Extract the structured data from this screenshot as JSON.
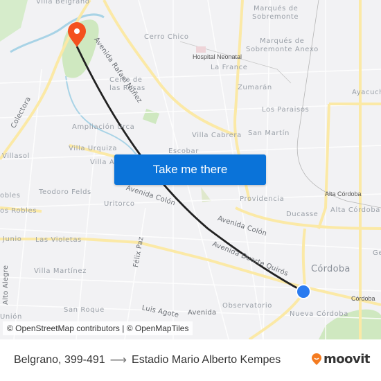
{
  "map": {
    "labels": {
      "villa_belgrano": "Villa Belgrano",
      "cerro_chico": "Cerro Chico",
      "cerro_rosas_1": "Cerro de",
      "cerro_rosas_2": "las Rosas",
      "av_rafael_nunez": "Avenida Rafael Núñez",
      "marques_1": "Marqués de",
      "marques_2": "Sobremonte",
      "marques_anexo_1": "Marqués de",
      "marques_anexo_2": "Sobremonte Anexo",
      "hospital": "Hospital Neonatal",
      "la_france": "La France",
      "zumaran": "Zumarán",
      "ayacucho": "Ayacucho",
      "colectora": "Colectora",
      "los_paraisos": "Los Paraisos",
      "ampliacion_urca": "Ampliación Urca",
      "villa_cabrera": "Villa Cabrera",
      "san_martin": "San Martín",
      "villasol": "Villasol",
      "villa_urquiza": "Villa Urquiza",
      "escobar": "Escobar",
      "villa_a": "Villa A",
      "teodoro_felds": "Teodoro Felds",
      "obles": "obles",
      "los_robles": "os Robles",
      "uritorco": "Uritorco",
      "av_colon_1": "Avenida Colón",
      "av_colon_2": "Avenida Colón",
      "alta_cordoba_poi": "Alta Córdoba",
      "alta_cordoba": "Alta Córdoba",
      "providencia": "Providencia",
      "ducasse": "Ducasse",
      "junio": "Junio",
      "las_violetas": "Las Violetas",
      "felix_paz": "Félix Paz",
      "av_duarte_quiros": "Avenida Duarte Quirós",
      "cordoba_city": "Córdoba",
      "villa_martinez": "Villa Martínez",
      "alto_alegre": "Alto Alegre",
      "ge": "Ge",
      "cordoba_poi": "Córdoba",
      "san_roque": "San Roque",
      "luis_agote": "Luis Agote",
      "avenida": "Avenida",
      "observatorio": "Observatorio",
      "union": "Unión",
      "nueva_cordoba": "Nueva Córdoba"
    },
    "cta_label": "Take me there",
    "attribution": "© OpenStreetMap contributors | © OpenMapTiles",
    "colors": {
      "destination_pin": "#f4511e",
      "origin_dot": "#2a7bf0",
      "route_line": "#222222",
      "cta_bg": "#0a73d9",
      "major_road": "#fbe9a6",
      "park": "#cfe8c0",
      "water": "#a8d3e6"
    }
  },
  "footer": {
    "origin": "Belgrano, 399-491",
    "arrow": "⟶",
    "destination": "Estadio Mario Alberto Kempes",
    "brand": "moovit",
    "brand_color": "#f47b20"
  }
}
